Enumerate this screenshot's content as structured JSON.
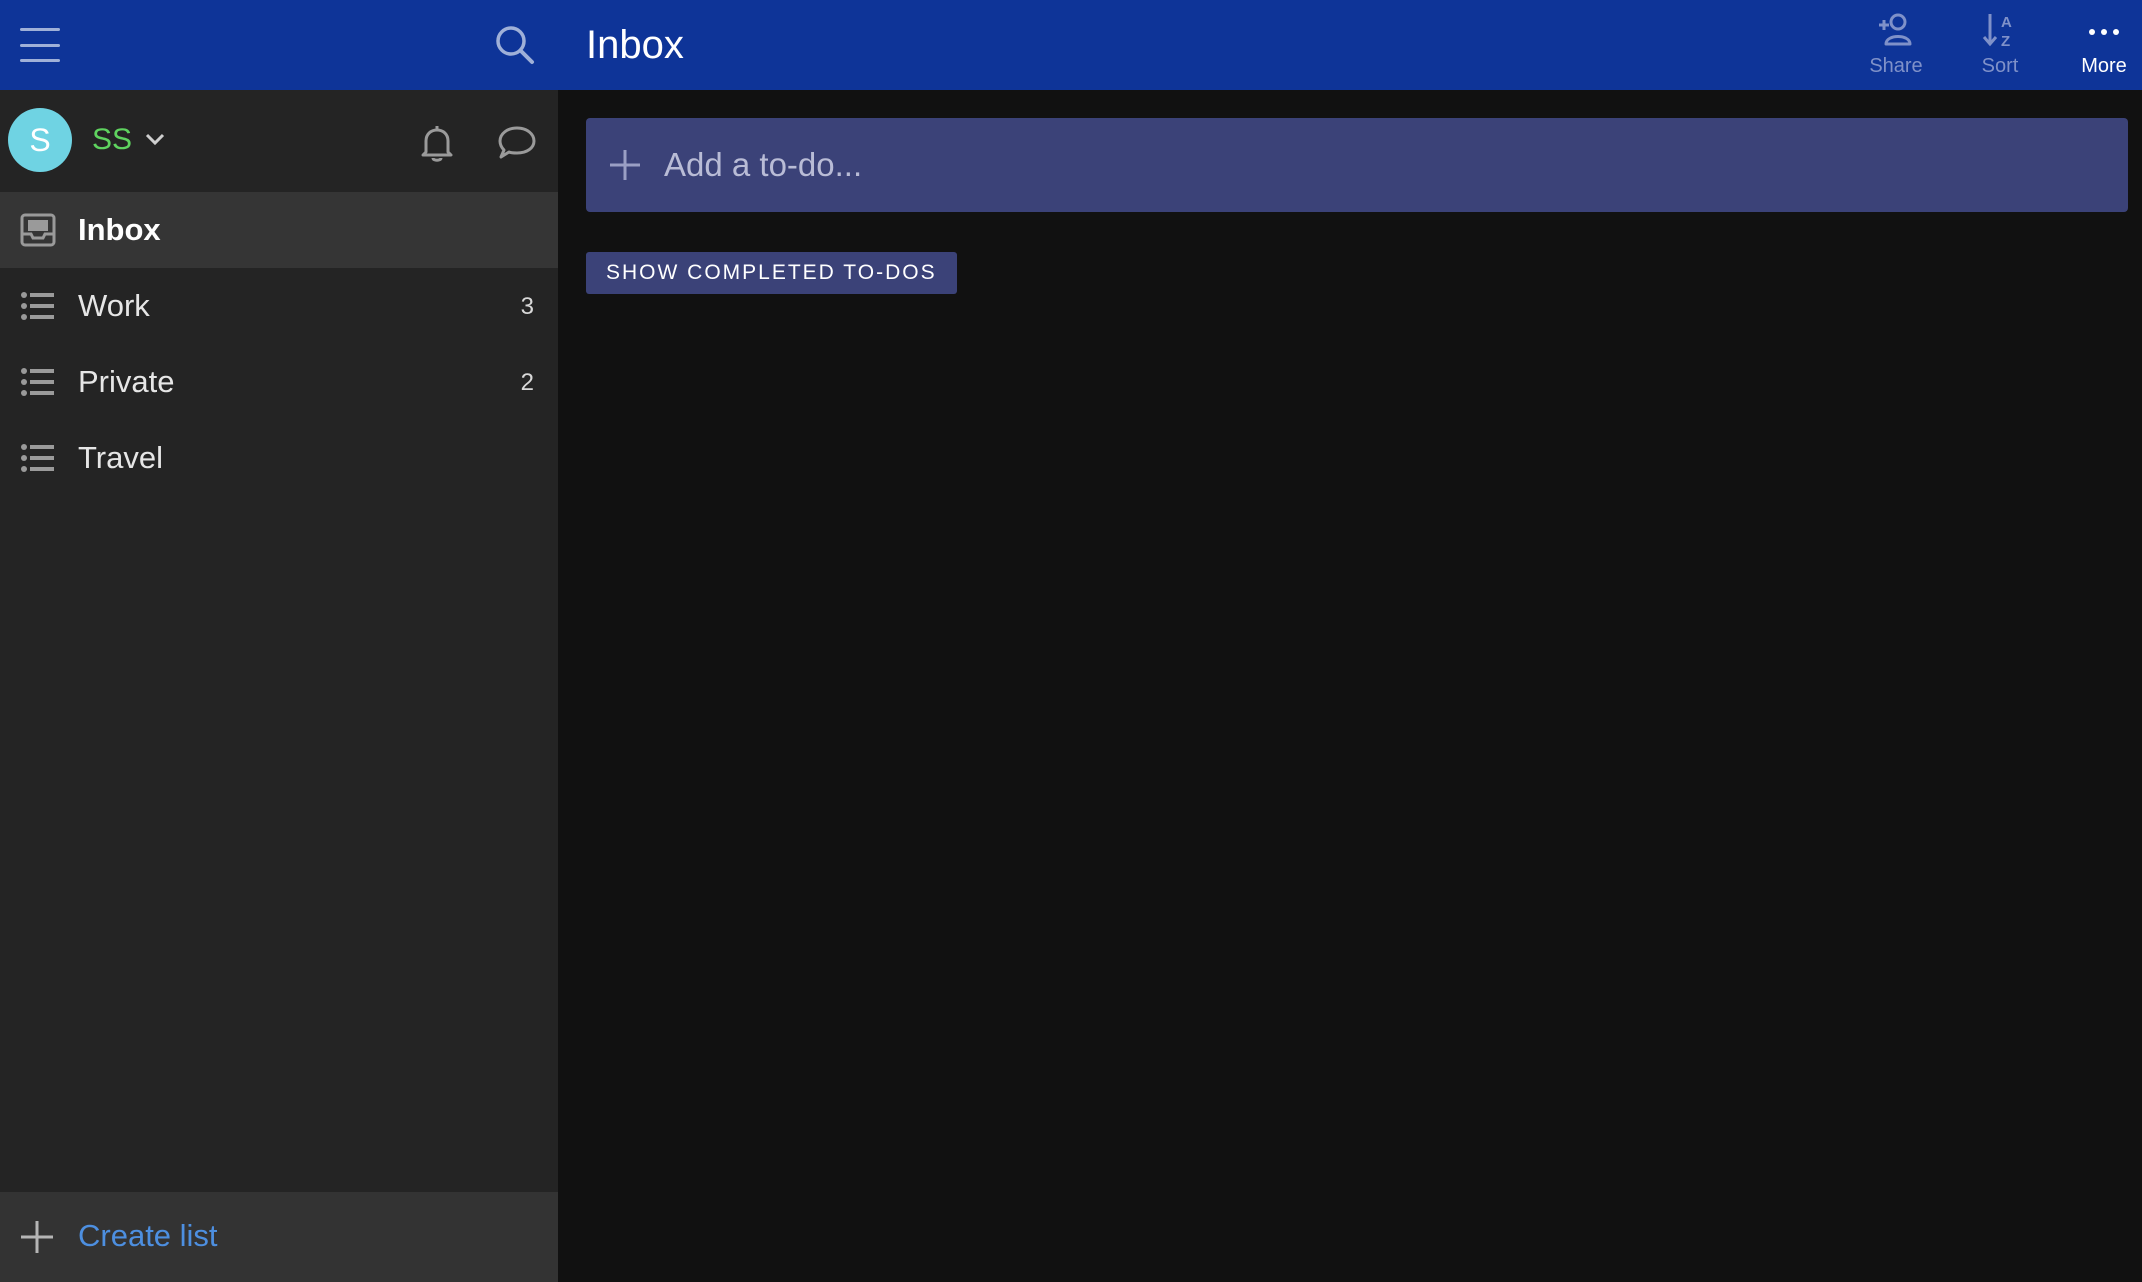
{
  "header": {
    "title": "Inbox",
    "menu_icon": "hamburger-menu-icon",
    "search_icon": "search-icon",
    "actions": [
      {
        "label": "Share",
        "icon": "add-person-icon"
      },
      {
        "label": "Sort",
        "icon": "sort-alpha-icon"
      },
      {
        "label": "More",
        "icon": "more-dots-icon"
      }
    ],
    "colors": {
      "bar": "#0e3498",
      "dim_action": "#7f91c9"
    }
  },
  "user": {
    "avatar_initial": "S",
    "name": "SS",
    "avatar_color": "#6fd3e3",
    "name_color": "#5fd35f"
  },
  "sidebar": {
    "items": [
      {
        "label": "Inbox",
        "count": "",
        "icon": "inbox-icon",
        "active": true
      },
      {
        "label": "Work",
        "count": "3",
        "icon": "list-icon",
        "active": false
      },
      {
        "label": "Private",
        "count": "2",
        "icon": "list-icon",
        "active": false
      },
      {
        "label": "Travel",
        "count": "",
        "icon": "list-icon",
        "active": false
      }
    ],
    "create_list_label": "Create list",
    "create_list_color": "#4d8fe0"
  },
  "main": {
    "add_todo_placeholder": "Add a to-do...",
    "show_completed_label": "SHOW COMPLETED TO-DOS",
    "accent": "#3b4278"
  }
}
